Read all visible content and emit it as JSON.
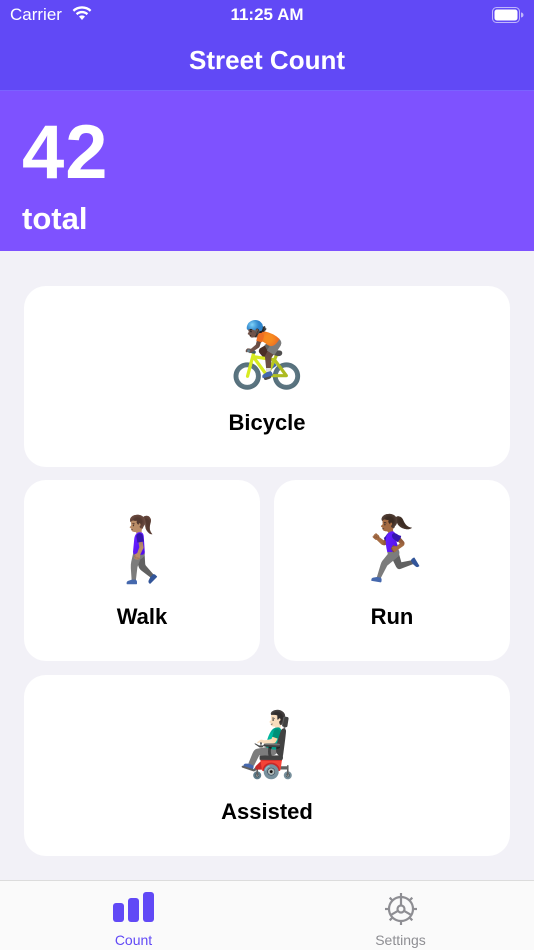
{
  "status_bar": {
    "carrier": "Carrier",
    "time": "11:25 AM",
    "wifi_icon": "wifi-icon",
    "battery_icon": "battery-full-icon"
  },
  "nav": {
    "title": "Street Count"
  },
  "total": {
    "value": "42",
    "label": "total"
  },
  "categories": [
    {
      "id": "bicycle",
      "emoji": "🚴🏿",
      "label": "Bicycle"
    },
    {
      "id": "walk",
      "emoji": "🚶🏽‍♀️",
      "label": "Walk"
    },
    {
      "id": "run",
      "emoji": "🏃🏾‍♀️",
      "label": "Run"
    },
    {
      "id": "assisted",
      "emoji": "👨🏻‍🦼",
      "label": "Assisted"
    }
  ],
  "tabs": [
    {
      "id": "count",
      "label": "Count",
      "icon": "bar-chart-icon",
      "selected": true
    },
    {
      "id": "settings",
      "label": "Settings",
      "icon": "gear-icon",
      "selected": false
    }
  ],
  "colors": {
    "header_purple": "#6149f6",
    "total_panel_purple": "#7e52ff",
    "tab_active": "#6149f6",
    "tab_inactive": "#8e8e93",
    "background": "#f2f1f7"
  }
}
